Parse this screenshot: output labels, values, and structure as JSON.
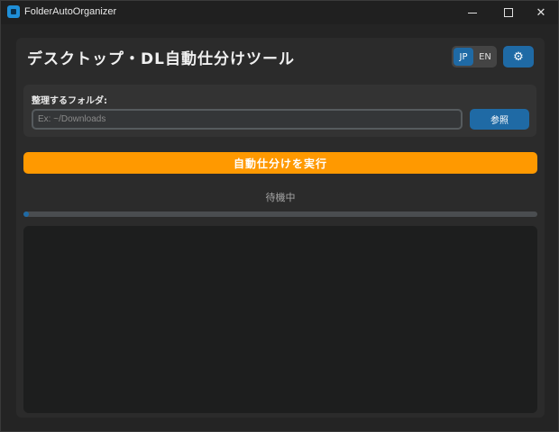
{
  "window": {
    "app_title": "FolderAutoOrganizer",
    "icons": {
      "app": "app-folder-icon",
      "minimize": "minimize-icon",
      "maximize": "maximize-icon",
      "close": "close-icon"
    }
  },
  "header": {
    "title": "デスクトップ・DL自動仕分けツール",
    "lang_jp": "JP",
    "lang_en": "EN",
    "active_lang": "JP",
    "settings_icon": "gear-icon"
  },
  "folder": {
    "label": "整理するフォルダ:",
    "placeholder": "Ex: ~/Downloads",
    "value": "",
    "browse_label": "参照"
  },
  "actions": {
    "run_label": "自動仕分けを実行"
  },
  "status": {
    "text": "待機中",
    "progress": 0.01
  },
  "log": {
    "content": ""
  },
  "colors": {
    "accent": "#1f6aa5",
    "run_button": "#ff9900",
    "background": "#242424"
  }
}
